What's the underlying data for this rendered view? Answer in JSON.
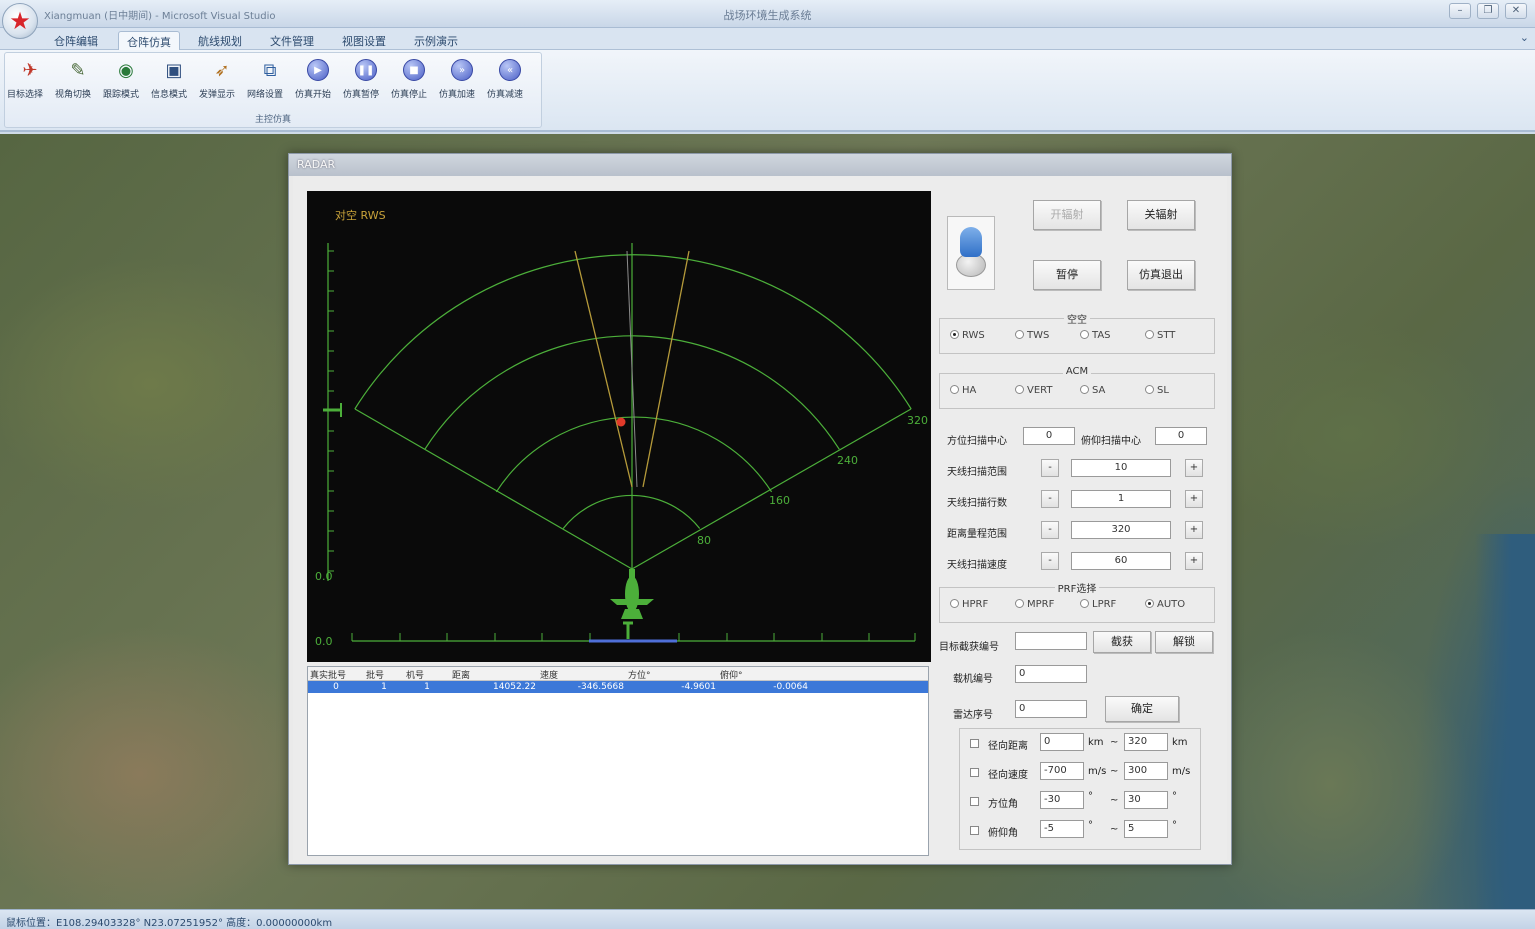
{
  "window": {
    "title": "战场环境生成系统",
    "quick_access": "Xiangmuan (日中期间) - Microsoft Visual Studio",
    "controls": [
      "–",
      "❐",
      "✕"
    ]
  },
  "ribbon": {
    "tabs": [
      "仓阵编辑",
      "仓阵仿真",
      "航线规划",
      "文件管理",
      "视图设置",
      "示例演示"
    ],
    "active_tab": "仓阵仿真",
    "help_icon": "help-icon",
    "group_label": "主控仿真",
    "buttons": [
      {
        "label": "目标选择",
        "icon": "target-select-icon"
      },
      {
        "label": "视角切换",
        "icon": "view-switch-icon"
      },
      {
        "label": "跟踪模式",
        "icon": "globe-track-icon"
      },
      {
        "label": "信息模式",
        "icon": "monitor-info-icon"
      },
      {
        "label": "发弹显示",
        "icon": "missile-icon"
      },
      {
        "label": "网络设置",
        "icon": "network-icon"
      },
      {
        "label": "仿真开始",
        "icon": "play-icon"
      },
      {
        "label": "仿真暂停",
        "icon": "pause-icon"
      },
      {
        "label": "仿真停止",
        "icon": "stop-icon"
      },
      {
        "label": "仿真加速",
        "icon": "fast-forward-icon"
      },
      {
        "label": "仿真减速",
        "icon": "rewind-icon"
      }
    ]
  },
  "radar": {
    "window_title": "RADAR",
    "mode_text": "对空 RWS",
    "scale_left_labels": [
      "0.0",
      "0.0"
    ],
    "range_labels": [
      "80",
      "160",
      "240",
      "320"
    ],
    "table": {
      "columns": [
        "真实批号",
        "批号",
        "机号",
        "距离",
        "速度",
        "方位°",
        "俯仰°"
      ],
      "rows": [
        [
          "0",
          "1",
          "1",
          "14052.22",
          "-346.5668",
          "-4.9601",
          "-0.0064"
        ]
      ]
    },
    "buttons": {
      "radiate_on": "开辐射",
      "radiate_off": "关辐射",
      "pause": "暂停",
      "exit": "仿真退出",
      "intercept": "截获",
      "unlock": "解锁",
      "confirm": "确定"
    },
    "air_mode": {
      "legend": "空空",
      "options": [
        "RWS",
        "TWS",
        "TAS",
        "STT"
      ],
      "selected": "RWS"
    },
    "acm_mode": {
      "legend": "ACM",
      "options": [
        "HA",
        "VERT",
        "SA",
        "SL"
      ],
      "selected": ""
    },
    "scan": {
      "az_center_label": "方位扫描中心",
      "az_center_value": "0",
      "el_center_label": "俯仰扫描中心",
      "el_center_value": "0",
      "rows": [
        {
          "label": "天线扫描范围",
          "value": "10"
        },
        {
          "label": "天线扫描行数",
          "value": "1"
        },
        {
          "label": "距离量程范围",
          "value": "320"
        },
        {
          "label": "天线扫描速度",
          "value": "60"
        }
      ],
      "minus": "-",
      "plus": "+"
    },
    "prf": {
      "legend": "PRF选择",
      "options": [
        "HPRF",
        "MPRF",
        "LPRF",
        "AUTO"
      ],
      "selected": "AUTO"
    },
    "target_intercept_label": "目标截获编号",
    "target_intercept_value": "",
    "aircraft_no_label": "载机编号",
    "aircraft_no_value": "0",
    "radar_no_label": "雷达序号",
    "radar_no_value": "0",
    "filters": [
      {
        "label": "径向距离",
        "min": "0",
        "max": "320",
        "unit1": "km",
        "unit2": "km"
      },
      {
        "label": "径向速度",
        "min": "-700",
        "max": "300",
        "unit1": "m/s",
        "unit2": "m/s"
      },
      {
        "label": "方位角",
        "min": "-30",
        "max": "30",
        "unit1": "°",
        "unit2": "°"
      },
      {
        "label": "俯仰角",
        "min": "-5",
        "max": "5",
        "unit1": "°",
        "unit2": "°"
      }
    ],
    "range_sep": "~"
  },
  "status_bar": "鼠标位置：E108.29403328° N23.07251952°  高度：0.00000000km",
  "colors": {
    "radar_green": "#4caf3a",
    "scan_yellow": "#b59a3a",
    "target_red": "#e23a2a",
    "selection_blue": "#3c78d8"
  }
}
